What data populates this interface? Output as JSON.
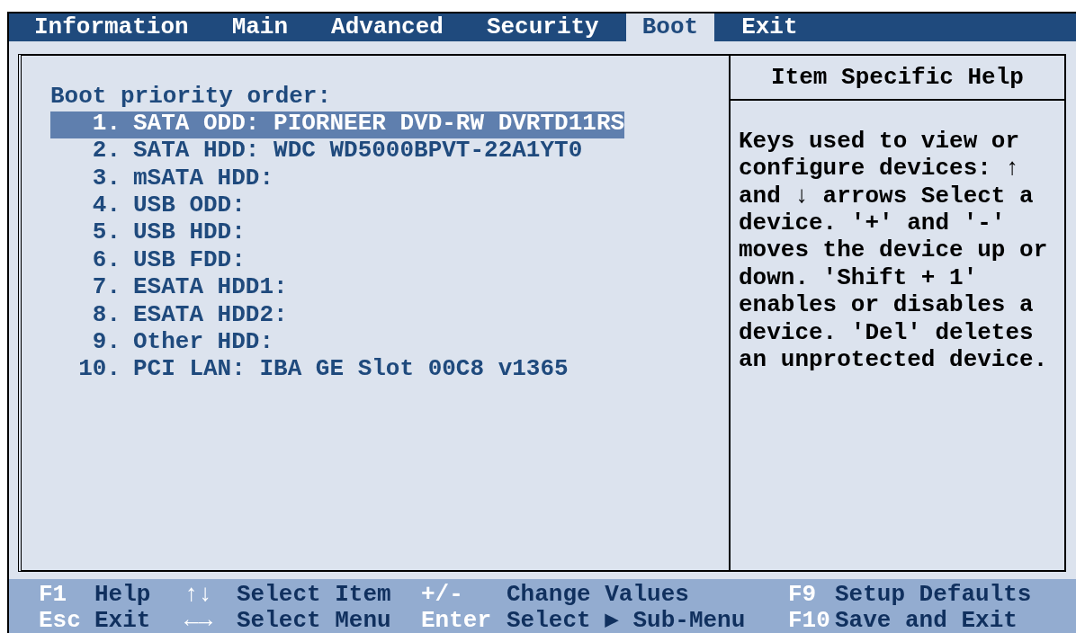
{
  "tabs": [
    {
      "label": "Information",
      "selected": false
    },
    {
      "label": "Main",
      "selected": false
    },
    {
      "label": "Advanced",
      "selected": false
    },
    {
      "label": "Security",
      "selected": false
    },
    {
      "label": "Boot",
      "selected": true
    },
    {
      "label": "Exit",
      "selected": false
    }
  ],
  "boot_list": {
    "heading": "Boot priority order:",
    "items": [
      {
        "number": "1.",
        "label": "SATA ODD: PIORNEER DVD-RW DVRTD11RS",
        "selected": true
      },
      {
        "number": "2.",
        "label": "SATA HDD: WDC WD5000BPVT-22A1YT0",
        "selected": false
      },
      {
        "number": "3.",
        "label": "mSATA HDD:",
        "selected": false
      },
      {
        "number": "4.",
        "label": "USB ODD:",
        "selected": false
      },
      {
        "number": "5.",
        "label": "USB HDD:",
        "selected": false
      },
      {
        "number": "6.",
        "label": "USB FDD:",
        "selected": false
      },
      {
        "number": "7.",
        "label": "ESATA HDD1:",
        "selected": false
      },
      {
        "number": "8.",
        "label": "ESATA HDD2:",
        "selected": false
      },
      {
        "number": "9.",
        "label": "Other HDD:",
        "selected": false
      },
      {
        "number": "10.",
        "label": "PCI LAN: IBA GE Slot 00C8 v1365",
        "selected": false
      }
    ]
  },
  "help": {
    "title": "Item Specific Help",
    "text": "Keys used to view or configure devices: ↑ and ↓ arrows Select a device. '+' and '-' moves the device up or down. 'Shift + 1' enables or disables a device. 'Del' deletes an unprotected device."
  },
  "footer": [
    [
      {
        "key": "F1",
        "label": "Help"
      },
      {
        "key": "↑↓",
        "label": "Select Item"
      },
      {
        "key": "+/-",
        "label": "Change Values"
      },
      {
        "key": "F9",
        "label": "Setup Defaults"
      }
    ],
    [
      {
        "key": "Esc",
        "label": "Exit"
      },
      {
        "key": "←→",
        "label": "Select Menu"
      },
      {
        "key": "Enter",
        "label": "Select ▶ Sub-Menu"
      },
      {
        "key": "F10",
        "label": "Save and Exit"
      }
    ]
  ]
}
